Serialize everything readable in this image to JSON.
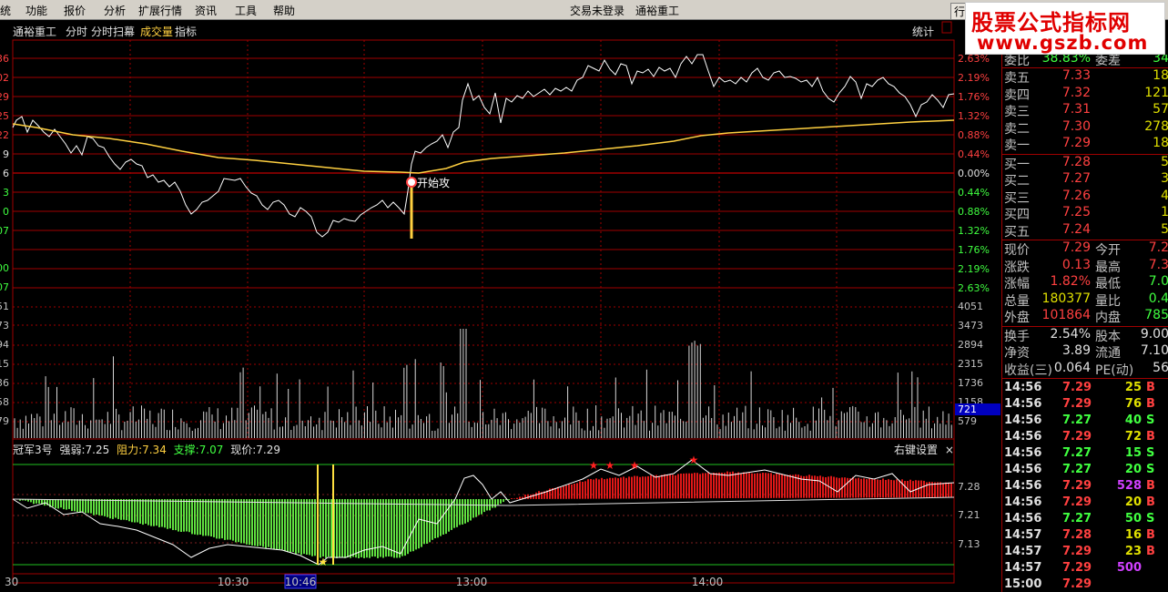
{
  "menu": {
    "items": [
      "统",
      "功能",
      "报价",
      "分析",
      "扩展行情",
      "资讯",
      "工具",
      "帮助"
    ],
    "login_status": "交易未登录",
    "stock_name": "通裕重工",
    "right_button": "行"
  },
  "banner": {
    "line1": "股票公式指标网",
    "line2": "www.gszb.com"
  },
  "chart_header": {
    "stock": "通裕重工",
    "mode1": "分时",
    "mode2": "分时扫幕",
    "volume": "成交量",
    "indicator": "指标",
    "stats": "统计"
  },
  "price_axis": {
    "left": [
      "36",
      "02",
      "29",
      "25",
      "22",
      "9",
      "6",
      "3",
      "0",
      "07",
      "00",
      "07"
    ],
    "right": [
      "2.63%",
      "2.19%",
      "1.76%",
      "1.32%",
      "0.88%",
      "0.44%",
      "0.00%",
      "0.44%",
      "0.88%",
      "1.32%",
      "1.76%",
      "2.19%",
      "2.63%"
    ]
  },
  "volume_axis": {
    "left": [
      "51",
      "73",
      "94",
      "15",
      "36",
      "58",
      "79"
    ],
    "right": [
      "4051",
      "3473",
      "2894",
      "2315",
      "1736",
      "1158",
      "579"
    ],
    "cursor_value": "721"
  },
  "annotation": {
    "label": "开始攻"
  },
  "indicator": {
    "name": "冠军3号",
    "strength_label": "强弱:",
    "strength_value": "7.25",
    "resistance_label": "阻力:",
    "resistance_value": "7.34",
    "support_label": "支撑:",
    "support_value": "7.07",
    "price_label": "现价:",
    "price_value": "7.29",
    "settings": "右键设置",
    "close": "×",
    "axis_right": [
      "7.28",
      "7.21",
      "7.13"
    ]
  },
  "time_axis": {
    "labels": [
      "30",
      "10:30",
      "10:46",
      "13:00",
      "14:00"
    ]
  },
  "quote": {
    "top_partial": {
      "label": "委比",
      "value": "38.83%",
      "label2": "委差",
      "value2": "34"
    },
    "sells": [
      {
        "label": "卖五",
        "price": "7.33",
        "vol": "18"
      },
      {
        "label": "卖四",
        "price": "7.32",
        "vol": "121"
      },
      {
        "label": "卖三",
        "price": "7.31",
        "vol": "57"
      },
      {
        "label": "卖二",
        "price": "7.30",
        "vol": "278"
      },
      {
        "label": "卖一",
        "price": "7.29",
        "vol": "18"
      }
    ],
    "buys": [
      {
        "label": "买一",
        "price": "7.28",
        "vol": "5"
      },
      {
        "label": "买二",
        "price": "7.27",
        "vol": "3"
      },
      {
        "label": "买三",
        "price": "7.26",
        "vol": "4"
      },
      {
        "label": "买四",
        "price": "7.25",
        "vol": "1"
      },
      {
        "label": "买五",
        "price": "7.24",
        "vol": "5"
      }
    ],
    "stats": [
      {
        "l1": "现价",
        "v1": "7.29",
        "l2": "今开",
        "v2": "7.2"
      },
      {
        "l1": "涨跌",
        "v1": "0.13",
        "l2": "最高",
        "v2": "7.3"
      },
      {
        "l1": "涨幅",
        "v1": "1.82%",
        "l2": "最低",
        "v2": "7.0"
      },
      {
        "l1": "总量",
        "v1": "180377",
        "l2": "量比",
        "v2": "0.4"
      },
      {
        "l1": "外盘",
        "v1": "101864",
        "l2": "内盘",
        "v2": "785"
      }
    ],
    "stats2": [
      {
        "l1": "换手",
        "v1": "2.54%",
        "l2": "股本",
        "v2": "9.00"
      },
      {
        "l1": "净资",
        "v1": "3.89",
        "l2": "流通",
        "v2": "7.10"
      },
      {
        "l1": "收益(三)",
        "v1": "0.064",
        "l2": "PE(动)",
        "v2": "56"
      }
    ]
  },
  "ticks": [
    {
      "t": "14:56",
      "p": "7.29",
      "v": "25",
      "d": "B"
    },
    {
      "t": "14:56",
      "p": "7.29",
      "v": "76",
      "d": "B"
    },
    {
      "t": "14:56",
      "p": "7.27",
      "v": "40",
      "d": "S"
    },
    {
      "t": "14:56",
      "p": "7.29",
      "v": "72",
      "d": "B"
    },
    {
      "t": "14:56",
      "p": "7.27",
      "v": "15",
      "d": "S"
    },
    {
      "t": "14:56",
      "p": "7.27",
      "v": "20",
      "d": "S"
    },
    {
      "t": "14:56",
      "p": "7.29",
      "v": "528",
      "d": "B"
    },
    {
      "t": "14:56",
      "p": "7.29",
      "v": "20",
      "d": "B"
    },
    {
      "t": "14:56",
      "p": "7.27",
      "v": "50",
      "d": "S"
    },
    {
      "t": "14:57",
      "p": "7.28",
      "v": "16",
      "d": "B"
    },
    {
      "t": "14:57",
      "p": "7.29",
      "v": "23",
      "d": "B"
    },
    {
      "t": "14:57",
      "p": "7.29",
      "v": "500",
      "d": ""
    },
    {
      "t": "15:00",
      "p": "7.29",
      "v": "",
      "d": ""
    }
  ],
  "colors": {
    "up": "#ff4040",
    "down": "#40ff40",
    "neutral": "#e0e0e0",
    "avg_line": "#ffd040",
    "grid": "#a00000",
    "big_vol": "#d040ff"
  }
}
